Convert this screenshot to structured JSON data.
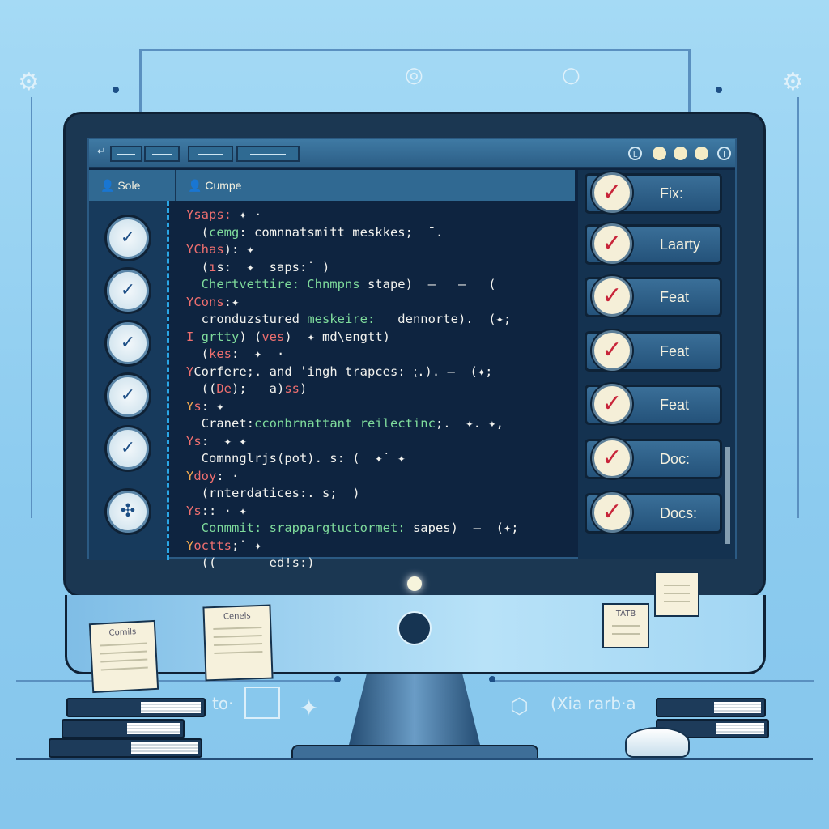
{
  "window": {
    "controls": [
      "L",
      "",
      "",
      "",
      "I"
    ]
  },
  "tabs": [
    {
      "label": "Sole"
    },
    {
      "label": "Cumpe"
    }
  ],
  "code_lines": [
    [
      {
        "t": "Y",
        "c": "r"
      },
      {
        "t": "saps: ",
        "c": "r"
      },
      {
        "t": "✦ ·",
        "c": "w"
      }
    ],
    [
      {
        "t": "  (",
        "c": "w"
      },
      {
        "t": "cemg",
        "c": "g"
      },
      {
        "t": ": comnnatsmitt meskkes;  ¯.",
        "c": "w"
      }
    ],
    [
      {
        "t": "Y",
        "c": "r"
      },
      {
        "t": "Chas",
        "c": "r"
      },
      {
        "t": "): ✦",
        "c": "w"
      }
    ],
    [
      {
        "t": "  (",
        "c": "w"
      },
      {
        "t": "ı",
        "c": "r"
      },
      {
        "t": "s:  ✦  saps:˙ )",
        "c": "w"
      }
    ],
    [
      {
        "t": "  Chertvettire: Chnmpns ",
        "c": "g"
      },
      {
        "t": "stape)  –   –   (",
        "c": "w"
      }
    ],
    [
      {
        "t": "Y",
        "c": "r"
      },
      {
        "t": "Cons",
        "c": "r"
      },
      {
        "t": ":✦",
        "c": "w"
      }
    ],
    [
      {
        "t": "  cronduzstured ",
        "c": "w"
      },
      {
        "t": "meskeire:",
        "c": "g"
      },
      {
        "t": "   dennorte).  (✦;",
        "c": "w"
      }
    ],
    [
      {
        "t": "I ",
        "c": "r"
      },
      {
        "t": "grtty",
        "c": "g"
      },
      {
        "t": ") (",
        "c": "w"
      },
      {
        "t": "ves",
        "c": "r"
      },
      {
        "t": ")  ✦ md\\engtt)",
        "c": "w"
      }
    ],
    [
      {
        "t": "  (",
        "c": "w"
      },
      {
        "t": "kes",
        "c": "r"
      },
      {
        "t": ":  ✦  ·",
        "c": "w"
      }
    ],
    [
      {
        "t": "Y",
        "c": "r"
      },
      {
        "t": "Corfere;. and ˈingh trapces: ⁏.). –  (✦;",
        "c": "w"
      }
    ],
    [
      {
        "t": "  ((",
        "c": "w"
      },
      {
        "t": "De",
        "c": "r"
      },
      {
        "t": ");   a)",
        "c": "w"
      },
      {
        "t": "ss",
        "c": "r"
      },
      {
        "t": ")",
        "c": "w"
      }
    ],
    [
      {
        "t": "Y",
        "c": "y"
      },
      {
        "t": "s",
        "c": "r"
      },
      {
        "t": ": ✦",
        "c": "w"
      }
    ],
    [
      {
        "t": "  Cranet:",
        "c": "w"
      },
      {
        "t": "cconbrnattant reilectinc",
        "c": "g"
      },
      {
        "t": ";.  ✦. ✦,",
        "c": "w"
      }
    ],
    [
      {
        "t": "Y",
        "c": "r"
      },
      {
        "t": "s",
        "c": "r"
      },
      {
        "t": ":  ✦ ✦",
        "c": "w"
      }
    ],
    [
      {
        "t": "  Comnnglrjs(pot). s: (  ✦˙ ✦",
        "c": "w"
      }
    ],
    [
      {
        "t": "Y",
        "c": "y"
      },
      {
        "t": "doy",
        "c": "r"
      },
      {
        "t": ": ·",
        "c": "w"
      }
    ],
    [
      {
        "t": "  (rnterdatices:. s;  )",
        "c": "w"
      }
    ],
    [
      {
        "t": "Y",
        "c": "r"
      },
      {
        "t": "s",
        "c": "r"
      },
      {
        "t": ":: · ✦",
        "c": "w"
      }
    ],
    [
      {
        "t": "  Conmmit: ",
        "c": "g"
      },
      {
        "t": "srappargtuctormet:",
        "c": "g"
      },
      {
        "t": " sapes)  –  (✦;",
        "c": "w"
      }
    ],
    [
      {
        "t": "Y",
        "c": "y"
      },
      {
        "t": "octts",
        "c": "r"
      },
      {
        "t": ";˙ ✦",
        "c": "w"
      }
    ],
    [
      {
        "t": "  ((       ed!s:)",
        "c": "w"
      }
    ]
  ],
  "commit_types": [
    {
      "label": "Fix:"
    },
    {
      "label": "Laarty"
    },
    {
      "label": "Feat"
    },
    {
      "label": "Feat"
    },
    {
      "label": "Feat"
    },
    {
      "label": "Doc:"
    },
    {
      "label": "Docs:"
    }
  ],
  "sidebar_icons": [
    "check-icon",
    "check-icon",
    "check-icon",
    "check-icon",
    "check-icon",
    "tangle-icon"
  ],
  "notes": [
    {
      "title": "Comils"
    },
    {
      "title": "Cenels"
    },
    {
      "title": "TATB"
    },
    {
      "title": ""
    }
  ],
  "desk_labels": {
    "left": "to·",
    "right": "(Xia rarb·a"
  },
  "colors": {
    "background": "#8ccbef",
    "bezel": "#1b3752",
    "screen": "#0e2440",
    "keyword_red": "#ee6f6f",
    "keyword_green": "#7fdc9c",
    "check_red": "#c8253a"
  }
}
